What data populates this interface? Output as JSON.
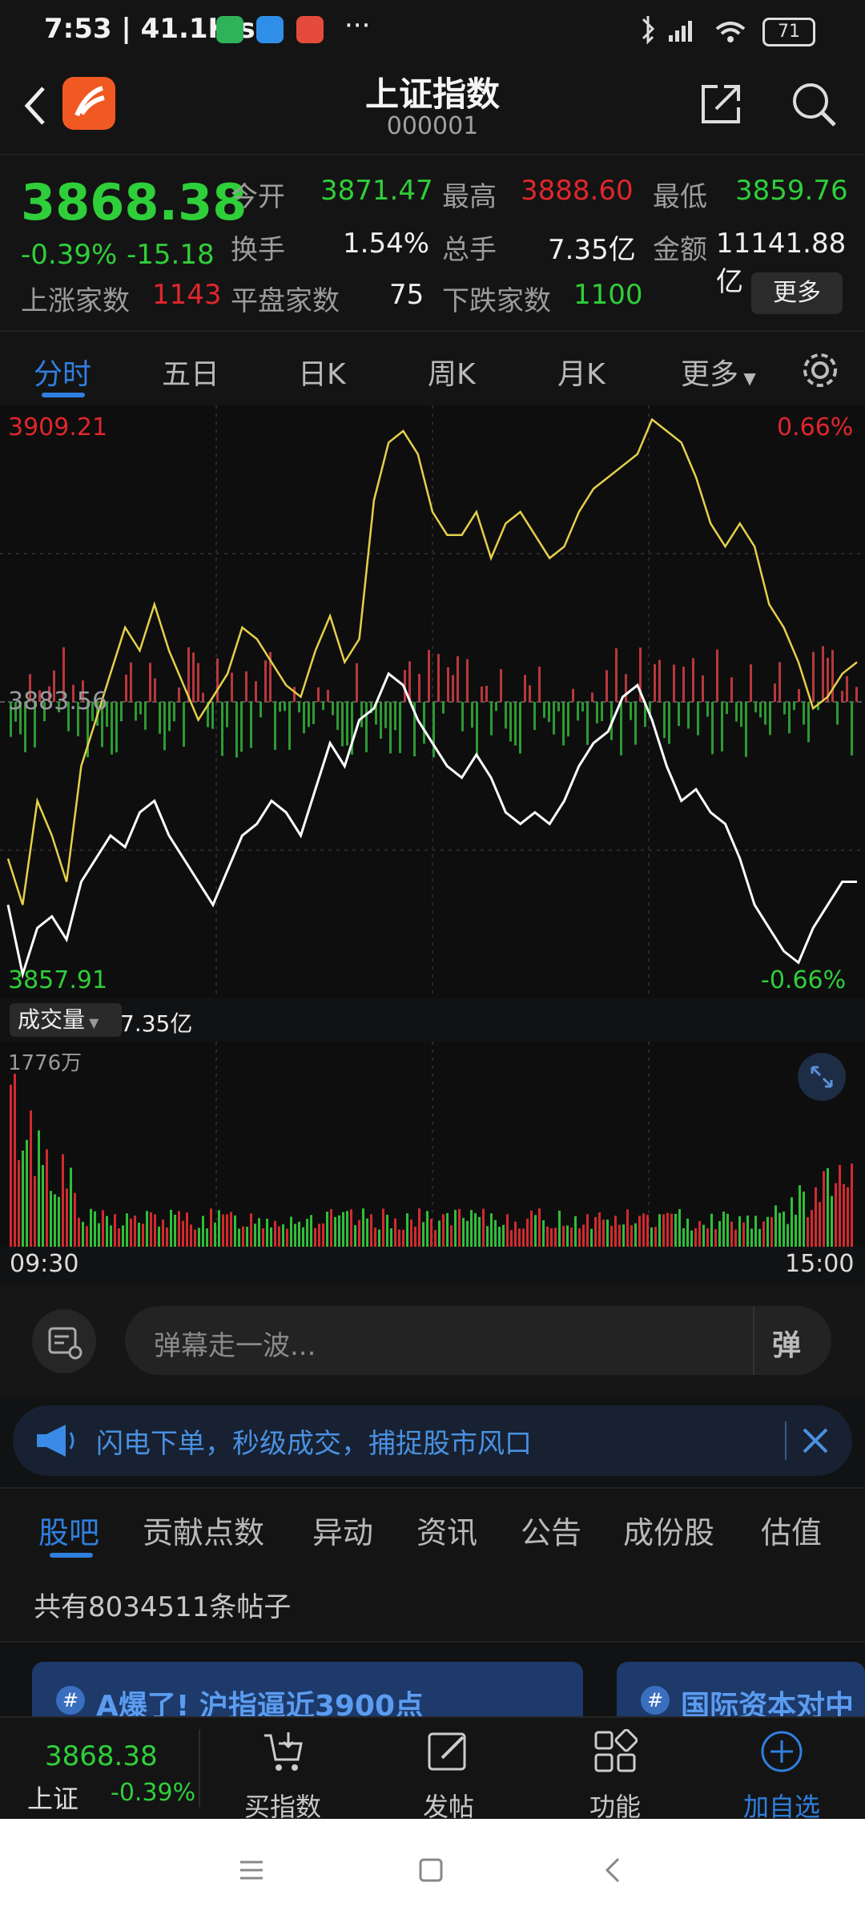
{
  "status_bar": {
    "time": "7:53 | 41.1K/s",
    "dots": "···",
    "battery": "71"
  },
  "nav": {
    "title": "上证指数",
    "code": "000001"
  },
  "quote": {
    "price": "3868.38",
    "change_pct": "-0.39%",
    "change": "-15.18",
    "open_label": "今开",
    "open": "3871.47",
    "high_label": "最高",
    "high": "3888.60",
    "low_label": "最低",
    "low": "3859.76",
    "turnover_label": "换手",
    "turnover": "1.54%",
    "volume_label": "总手",
    "volume": "7.35亿",
    "amount_label": "金额",
    "amount": "11141.88亿",
    "up_label": "上涨家数",
    "up": "1143",
    "flat_label": "平盘家数",
    "flat": "75",
    "down_label": "下跌家数",
    "down": "1100",
    "more_label": "更多"
  },
  "tabs": {
    "items": [
      "分时",
      "五日",
      "日K",
      "周K",
      "月K",
      "更多"
    ],
    "active": "分时"
  },
  "chart_data": {
    "type": "line",
    "y_top_label": "3909.21",
    "y_mid_label": "3883.56",
    "y_bottom_label": "3857.91",
    "pct_top_label": "0.66%",
    "pct_bottom_label": "-0.66%",
    "ylim": [
      3857.91,
      3909.21
    ],
    "series": [
      {
        "values": [
          3870,
          3866,
          3875,
          3872,
          3868,
          3878,
          3882,
          3886,
          3890,
          3888,
          3892,
          3888,
          3885,
          3882,
          3884,
          3886,
          3890,
          3889,
          3887,
          3885,
          3884,
          3888,
          3891,
          3887,
          3889,
          3901,
          3906,
          3907,
          3905,
          3900,
          3898,
          3898,
          3900,
          3896,
          3899,
          3900,
          3898,
          3896,
          3897,
          3900,
          3902,
          3903,
          3904,
          3905,
          3908,
          3907,
          3906,
          3903,
          3899,
          3897,
          3899,
          3897,
          3892,
          3890,
          3887,
          3883,
          3884,
          3886,
          3887
        ]
      },
      {
        "values": [
          3866,
          3860,
          3864,
          3865,
          3863,
          3868,
          3870,
          3872,
          3871,
          3874,
          3875,
          3872,
          3870,
          3868,
          3866,
          3869,
          3872,
          3873,
          3875,
          3874,
          3872,
          3876,
          3880,
          3878,
          3882,
          3883,
          3886,
          3885,
          3882,
          3880,
          3878,
          3877,
          3879,
          3877,
          3874,
          3873,
          3874,
          3873,
          3875,
          3878,
          3880,
          3881,
          3884,
          3885,
          3882,
          3878,
          3875,
          3876,
          3874,
          3873,
          3870,
          3866,
          3864,
          3862,
          3861,
          3864,
          3866,
          3868,
          3868
        ]
      }
    ],
    "x_labels": [
      "09:30",
      "15:00"
    ]
  },
  "volume": {
    "selector_label": "成交量",
    "total": "7.35亿",
    "max_label": "1776万"
  },
  "comment": {
    "placeholder": "弹幕走一波...",
    "barrage_label": "弹"
  },
  "banner": {
    "text": "闪电下单，秒级成交，捕捉股市风口"
  },
  "subtabs": {
    "items": [
      "股吧",
      "贡献点数",
      "异动",
      "资讯",
      "公告",
      "成份股",
      "估值"
    ],
    "active": "股吧"
  },
  "posts": {
    "count_text": "共有8034511条帖子"
  },
  "cards": [
    {
      "text": "A爆了! 沪指逼近3900点"
    },
    {
      "text": "国际资本对中"
    }
  ],
  "bottom_bar": {
    "price": "3868.38",
    "name": "上证",
    "pct": "-0.39%",
    "buy_label": "买指数",
    "post_label": "发帖",
    "func_label": "功能",
    "add_label": "加自选"
  },
  "colors": {
    "up": "#e0262c",
    "down": "#2fcf3a",
    "accent": "#2f7fe0",
    "line_price": "#e5d04a",
    "line_avg": "#ffffff"
  }
}
